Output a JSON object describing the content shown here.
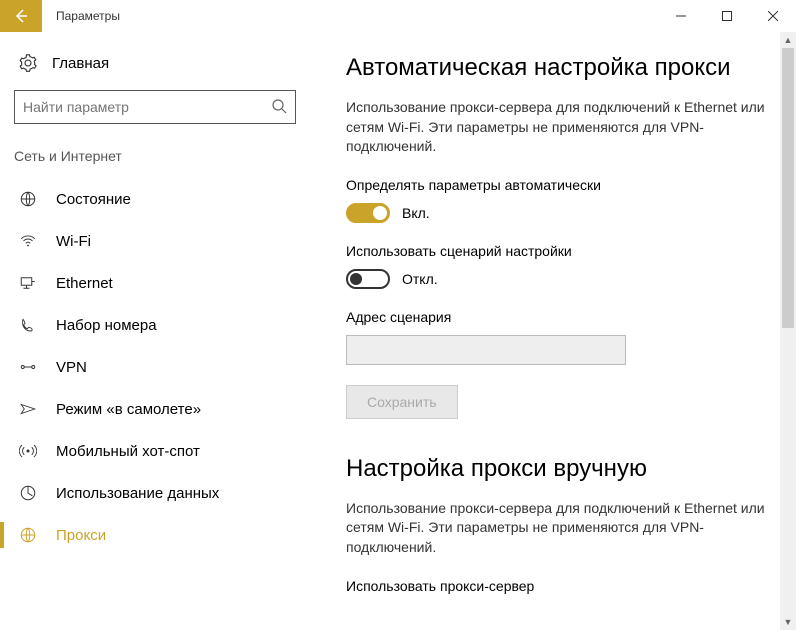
{
  "window": {
    "title": "Параметры"
  },
  "sidebar": {
    "home": "Главная",
    "searchPlaceholder": "Найти параметр",
    "category": "Сеть и Интернет",
    "items": [
      {
        "label": "Состояние"
      },
      {
        "label": "Wi-Fi"
      },
      {
        "label": "Ethernet"
      },
      {
        "label": "Набор номера"
      },
      {
        "label": "VPN"
      },
      {
        "label": "Режим «в самолете»"
      },
      {
        "label": "Мобильный хот-спот"
      },
      {
        "label": "Использование данных"
      },
      {
        "label": "Прокси"
      }
    ]
  },
  "main": {
    "autoHeading": "Автоматическая настройка прокси",
    "autoDesc": "Использование прокси-сервера для подключений к Ethernet или сетям Wi-Fi. Эти параметры не применяются для VPN-подключений.",
    "detectLabel": "Определять параметры автоматически",
    "onLabel": "Вкл.",
    "scriptLabel": "Использовать сценарий настройки",
    "offLabel": "Откл.",
    "addressLabel": "Адрес сценария",
    "saveLabel": "Сохранить",
    "manualHeading": "Настройка прокси вручную",
    "manualDesc": "Использование прокси-сервера для подключений к Ethernet или сетям Wi-Fi. Эти параметры не применяются для VPN-подключений.",
    "useProxyLabel": "Использовать прокси-сервер"
  }
}
